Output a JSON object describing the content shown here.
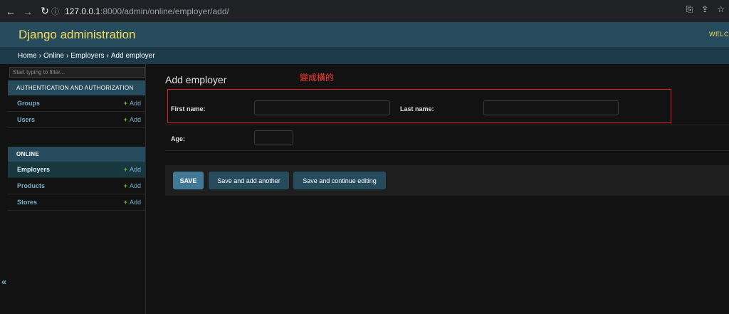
{
  "browser": {
    "url_host": "127.0.0.1",
    "url_rest": ":8000/admin/online/employer/add/"
  },
  "header": {
    "brand": "Django administration",
    "welcome": "WELC"
  },
  "breadcrumbs": [
    "Home",
    "›",
    "Online",
    "›",
    "Employers",
    "›",
    "Add employer"
  ],
  "sidebar": {
    "filter_placeholder": "Start typing to filter...",
    "modules": [
      {
        "caption": "AUTHENTICATION AND AUTHORIZATION",
        "models": [
          {
            "name": "Groups",
            "add": "Add"
          },
          {
            "name": "Users",
            "add": "Add"
          }
        ]
      },
      {
        "caption": "ONLINE",
        "models": [
          {
            "name": "Employers",
            "add": "Add"
          },
          {
            "name": "Products",
            "add": "Add"
          },
          {
            "name": "Stores",
            "add": "Add"
          }
        ]
      }
    ],
    "collapse_glyph": "«"
  },
  "content": {
    "title": "Add employer",
    "annotation": "變成橫的",
    "fields": {
      "first_name_label": "First name:",
      "last_name_label": "Last name:",
      "age_label": "Age:",
      "first_name_value": "",
      "last_name_value": "",
      "age_value": ""
    },
    "buttons": {
      "save": "SAVE",
      "save_add_another": "Save and add another",
      "save_continue": "Save and continue editing"
    }
  },
  "colors": {
    "header_bg": "#264b5d",
    "brand": "#f5dd5d",
    "link": "#79aec8",
    "add_plus": "#70bf2b",
    "annotation_red": "#ff3b30"
  }
}
